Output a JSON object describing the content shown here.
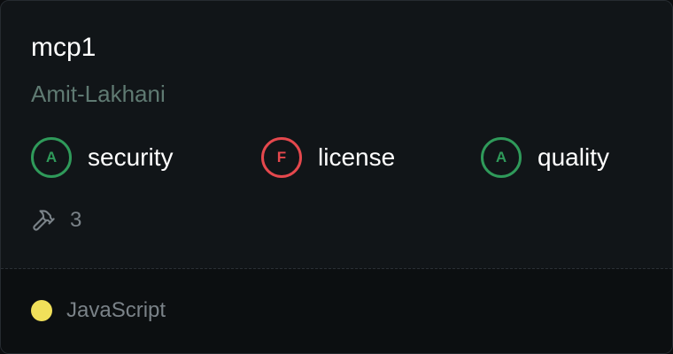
{
  "server": {
    "name": "mcp1",
    "author": "Amit-Lakhani"
  },
  "scores": [
    {
      "grade": "A",
      "label": "security",
      "status": "pass",
      "color": "#2f9a5a"
    },
    {
      "grade": "F",
      "label": "license",
      "status": "fail",
      "color": "#e5484d"
    },
    {
      "grade": "A",
      "label": "quality",
      "status": "pass",
      "color": "#2f9a5a"
    }
  ],
  "tools": {
    "icon": "hammer-icon",
    "count": "3"
  },
  "language": {
    "name": "JavaScript",
    "color": "#f1e05a"
  }
}
